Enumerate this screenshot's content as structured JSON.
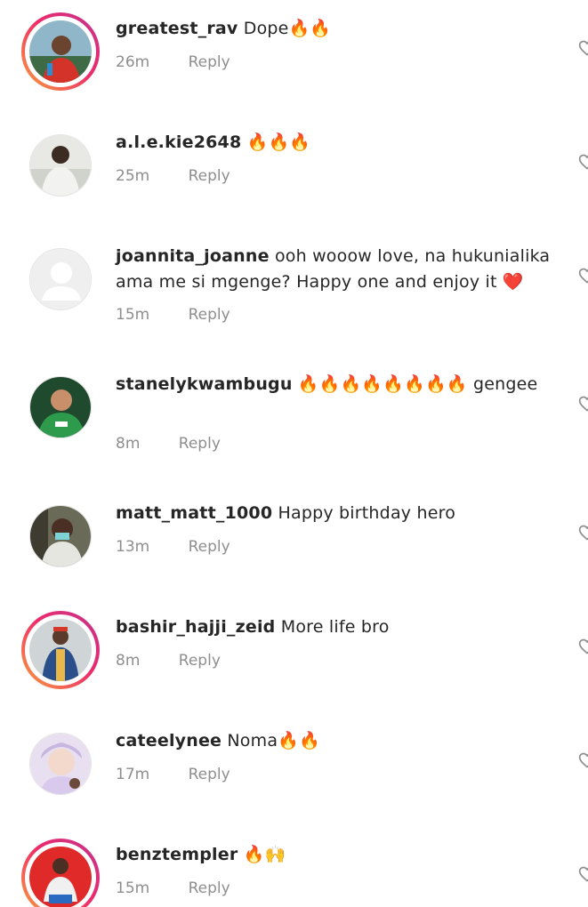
{
  "comments": [
    {
      "username": "greatest_rav",
      "text": "Dope🔥🔥",
      "time": "26m",
      "reply": "Reply"
    },
    {
      "username": "a.l.e.kie2648",
      "text": "🔥🔥🔥",
      "time": "25m",
      "reply": "Reply"
    },
    {
      "username": "joannita_joanne",
      "text": "ooh wooow love, na hukunialika ama me si mgenge? Happy one and enjoy it ❤️",
      "time": "15m",
      "reply": "Reply"
    },
    {
      "username": "stanelykwambugu",
      "text": "🔥🔥🔥🔥🔥🔥🔥🔥 gengee",
      "time": "8m",
      "reply": "Reply"
    },
    {
      "username": "matt_matt_1000",
      "text": "Happy birthday  hero",
      "time": "13m",
      "reply": "Reply"
    },
    {
      "username": "bashir_hajji_zeid",
      "text": "More life bro",
      "time": "8m",
      "reply": "Reply"
    },
    {
      "username": "cateelynee",
      "text": "Noma🔥🔥",
      "time": "17m",
      "reply": "Reply"
    },
    {
      "username": "benztempler",
      "text": "🔥🙌",
      "time": "15m",
      "reply": "Reply"
    }
  ],
  "icons": {
    "like": "heart-outline-icon"
  },
  "colors": {
    "story_ring_start": "#f9a23a",
    "story_ring_end": "#c1358f",
    "meta_gray": "#8e8e8e"
  }
}
